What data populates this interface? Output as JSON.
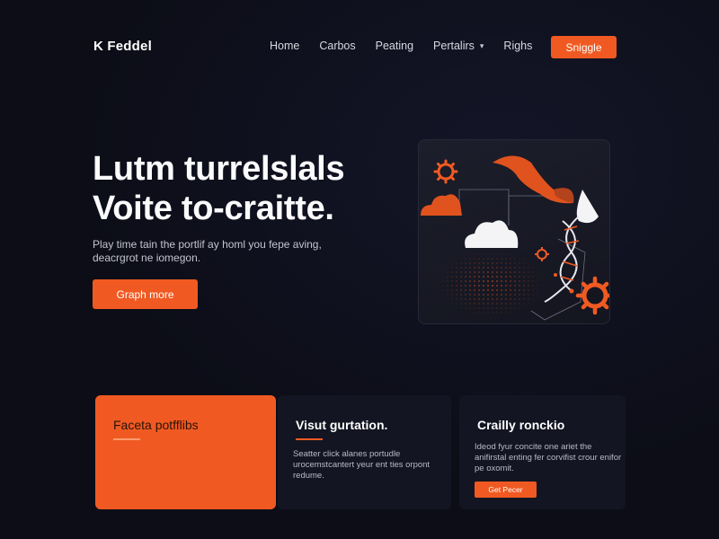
{
  "header": {
    "logo": "K Feddel",
    "nav": [
      {
        "label": "Home"
      },
      {
        "label": "Carbos"
      },
      {
        "label": "Peating"
      },
      {
        "label": "Pertalirs",
        "has_dropdown": true
      },
      {
        "label": "Righs"
      }
    ],
    "cta_label": "Sniggle"
  },
  "hero": {
    "title_line1": "Lutm turrelslals",
    "title_line2": "Voite to-craitte.",
    "subtitle_line1": "Play time tain the portlif ay homl you fepe aving,",
    "subtitle_line2": "deacrgrot ne iomegon.",
    "button_label": "Graph more"
  },
  "illustration": {
    "icons": [
      "gear-icon",
      "cloud-icon",
      "dna-helix-icon",
      "flame-shape-icon"
    ]
  },
  "cards": [
    {
      "title": "Faceta potfflibs",
      "body": ""
    },
    {
      "title": "Visut gurtation.",
      "body": "Seatter click alanes portudle urocemstcantert yeur ent ties orpont redume."
    },
    {
      "title": "Crailly ronckio",
      "body": "Ideod fyur concite one ariet the anifirstal enting fer corvifist crour enifor pe oxomit.",
      "button_label": "Get Pecer"
    }
  ],
  "colors": {
    "accent": "#f05a22",
    "background": "#0c0d17",
    "card_dark": "#131522"
  }
}
